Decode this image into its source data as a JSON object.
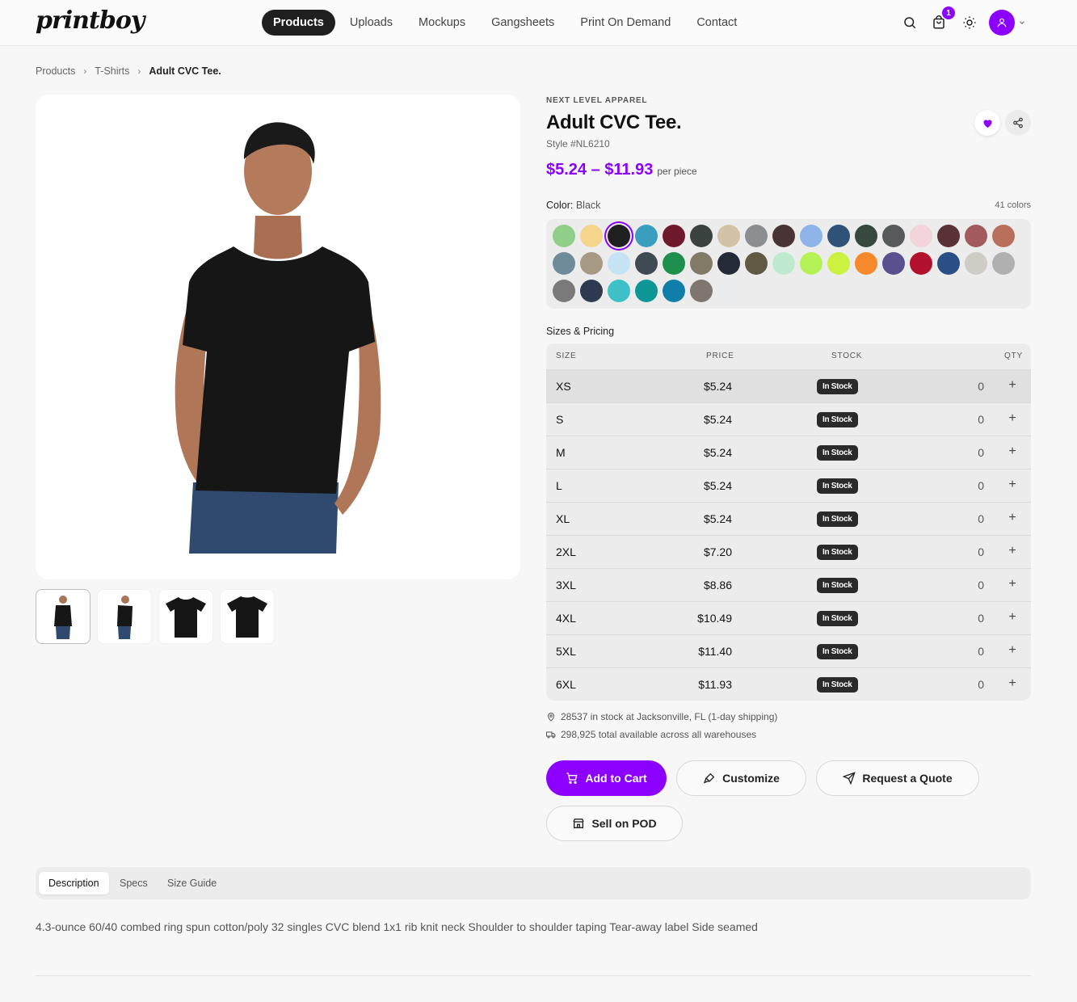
{
  "app": {
    "logo_text": "printboy"
  },
  "nav": {
    "items": [
      {
        "label": "Products",
        "active": true
      },
      {
        "label": "Uploads"
      },
      {
        "label": "Mockups"
      },
      {
        "label": "Gangsheets"
      },
      {
        "label": "Print On Demand"
      },
      {
        "label": "Contact"
      }
    ]
  },
  "header": {
    "cart_count": "1",
    "accent": "#8b00ff"
  },
  "breadcrumb": [
    "Products",
    "T-Shirts",
    "Adult CVC Tee."
  ],
  "product": {
    "brand": "NEXT LEVEL APPAREL",
    "title": "Adult CVC Tee.",
    "style": "Style #NL6210",
    "price_range": "$5.24 – $11.93",
    "price_unit": "per piece",
    "color_label": "Color:",
    "color_value": "Black",
    "color_count": "41 colors",
    "sizes_label": "Sizes & Pricing"
  },
  "swatches": [
    "#8fcf8a",
    "#f5d68c",
    "#1f1f1f",
    "#3a9fbf",
    "#6e1a2c",
    "#3b4340",
    "#d2c3a8",
    "#8c8f91",
    "#4a3334",
    "#8fb4e8",
    "#2e5278",
    "#37493e",
    "#565a5b",
    "#f2d4da",
    "#5a3134",
    "#a35a5f",
    "#b8705c",
    "#6f8b99",
    "#a89985",
    "#c5e3f2",
    "#3f4a55",
    "#1f8f4e",
    "#827a66",
    "#232a38",
    "#615942",
    "#bfeacf",
    "#b5f255",
    "#ccf23f",
    "#f5892b",
    "#5a4f8f",
    "#b3112b",
    "#2a4f87",
    "#cfccc6",
    "#b0b0b0",
    "#7a7a7a",
    "#2d3a4f",
    "#3ec0c9",
    "#0e9595",
    "#0f7ea8",
    "#7d7770",
    "#ebecee"
  ],
  "selected_swatch_index": 2,
  "table": {
    "headers": {
      "size": "SIZE",
      "price": "PRICE",
      "stock": "STOCK",
      "qty": "QTY"
    },
    "rows": [
      {
        "size": "XS",
        "price": "$5.24",
        "stock": "In Stock",
        "qty": "0",
        "plus": "+"
      },
      {
        "size": "S",
        "price": "$5.24",
        "stock": "In Stock",
        "qty": "0",
        "plus": "+"
      },
      {
        "size": "M",
        "price": "$5.24",
        "stock": "In Stock",
        "qty": "0",
        "plus": "+"
      },
      {
        "size": "L",
        "price": "$5.24",
        "stock": "In Stock",
        "qty": "0",
        "plus": "+"
      },
      {
        "size": "XL",
        "price": "$5.24",
        "stock": "In Stock",
        "qty": "0",
        "plus": "+"
      },
      {
        "size": "2XL",
        "price": "$7.20",
        "stock": "In Stock",
        "qty": "0",
        "plus": "+"
      },
      {
        "size": "3XL",
        "price": "$8.86",
        "stock": "In Stock",
        "qty": "0",
        "plus": "+"
      },
      {
        "size": "4XL",
        "price": "$10.49",
        "stock": "In Stock",
        "qty": "0",
        "plus": "+"
      },
      {
        "size": "5XL",
        "price": "$11.40",
        "stock": "In Stock",
        "qty": "0",
        "plus": "+"
      },
      {
        "size": "6XL",
        "price": "$11.93",
        "stock": "In Stock",
        "qty": "0",
        "plus": "+"
      }
    ]
  },
  "stock_info": {
    "local": "28537 in stock at Jacksonville, FL  (1-day shipping)",
    "total": "298,925 total available across all warehouses"
  },
  "actions": {
    "add_to_cart": "Add to Cart",
    "customize": "Customize",
    "request_quote": "Request a Quote",
    "sell_pod": "Sell on POD"
  },
  "tabs": [
    {
      "label": "Description",
      "active": true
    },
    {
      "label": "Specs"
    },
    {
      "label": "Size Guide"
    }
  ],
  "description": "4.3-ounce 60/40 combed ring spun cotton/poly 32 singles CVC blend 1x1 rib knit neck Shoulder to shoulder taping Tear-away label Side seamed"
}
